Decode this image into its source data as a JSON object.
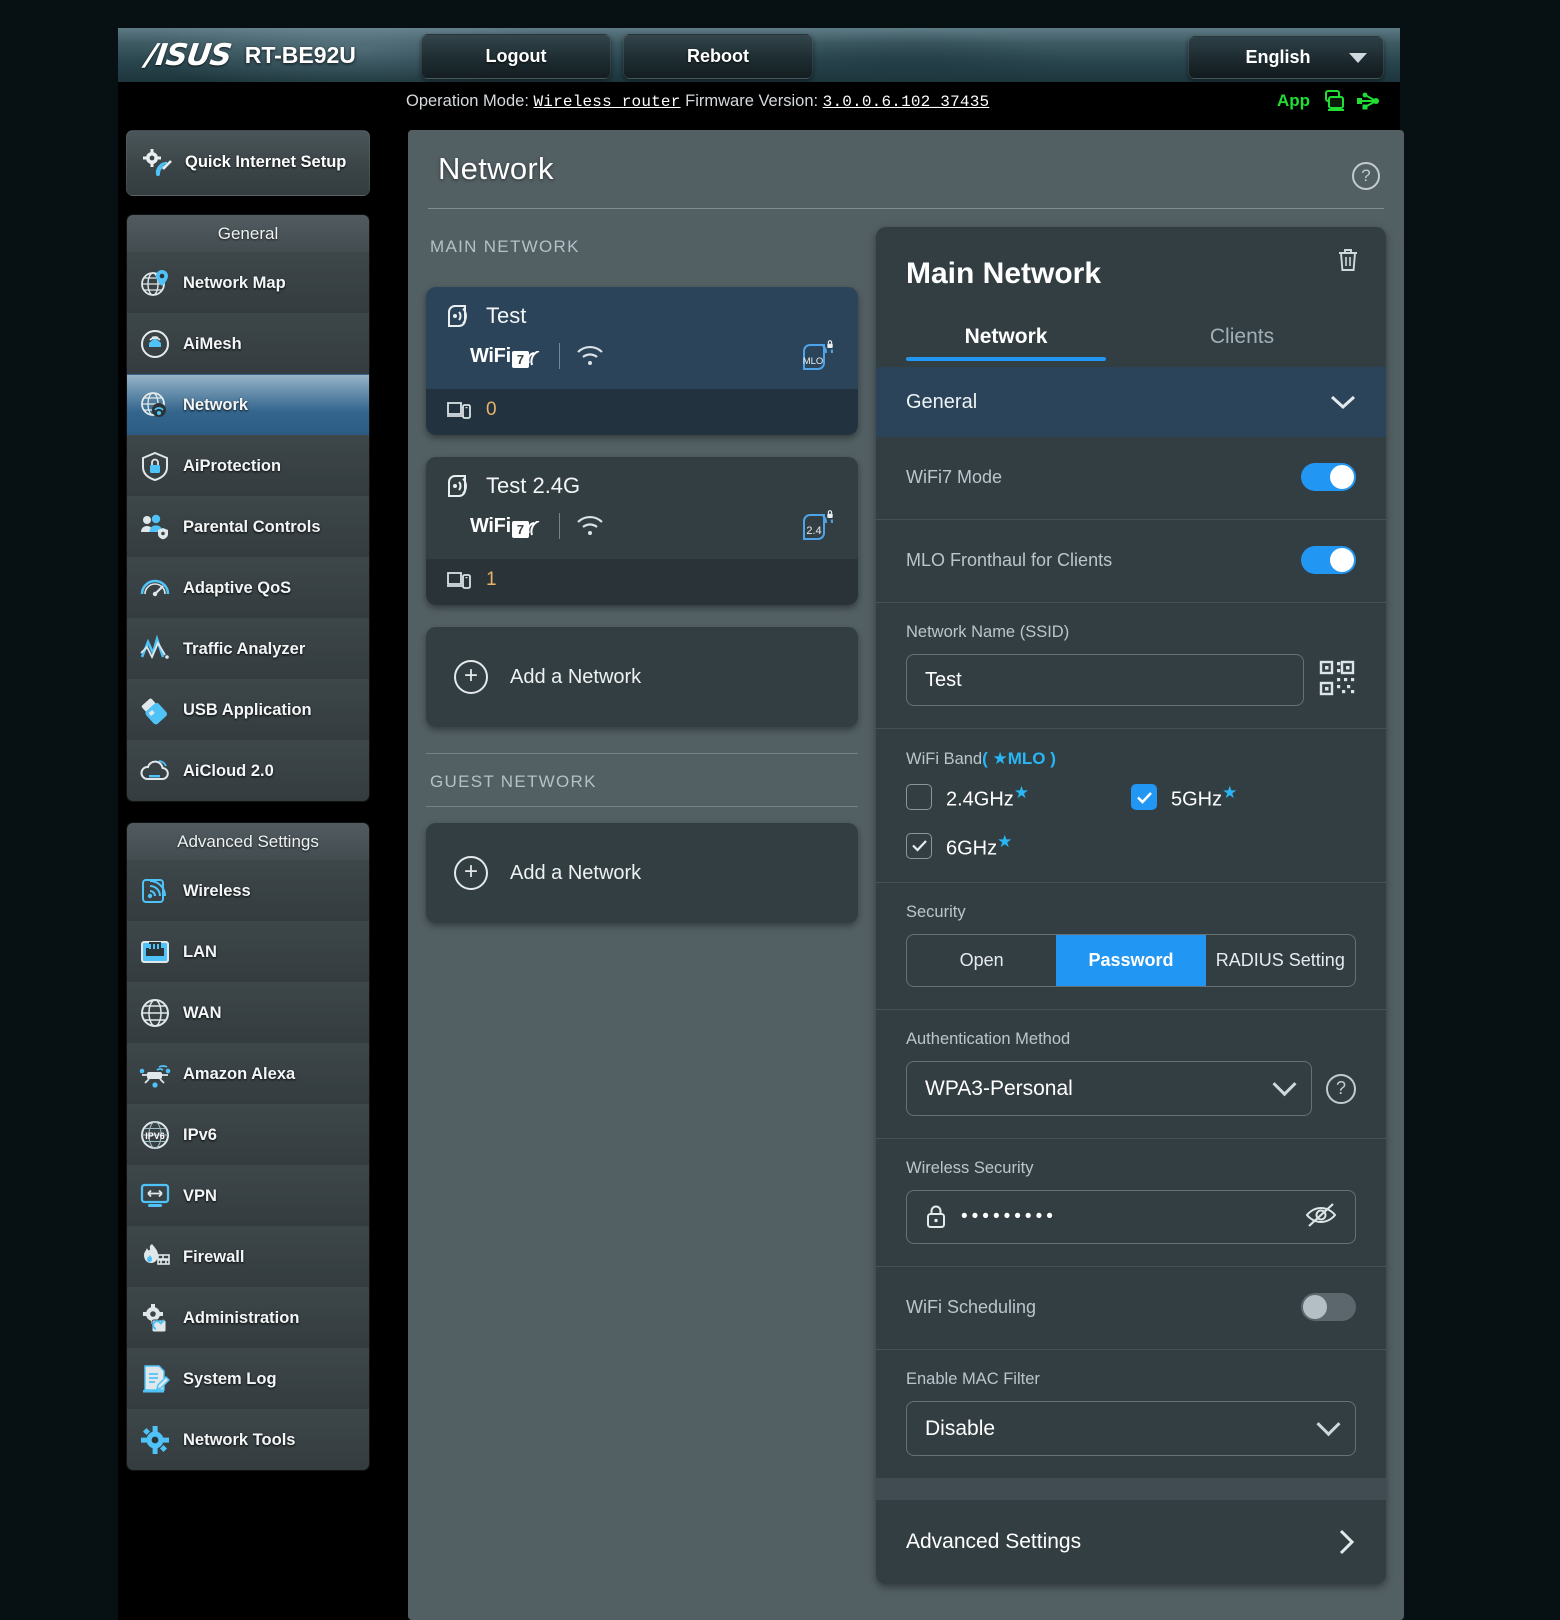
{
  "header": {
    "brand": "/ISUS",
    "model": "RT-BE92U",
    "logout_label": "Logout",
    "reboot_label": "Reboot",
    "language": "English",
    "app_label": "App"
  },
  "infobar": {
    "operation_mode_label": "Operation Mode:",
    "operation_mode_value": "Wireless router",
    "firmware_label": "Firmware Version:",
    "firmware_value": "3.0.0.6.102_37435"
  },
  "sidebar": {
    "quick_setup": "Quick Internet Setup",
    "general_header": "General",
    "general_items": [
      {
        "label": "Network Map",
        "icon": "network-map-icon"
      },
      {
        "label": "AiMesh",
        "icon": "aimesh-icon"
      },
      {
        "label": "Network",
        "icon": "network-icon",
        "active": true
      },
      {
        "label": "AiProtection",
        "icon": "shield-lock-icon"
      },
      {
        "label": "Parental Controls",
        "icon": "parental-controls-icon"
      },
      {
        "label": "Adaptive QoS",
        "icon": "gauge-icon"
      },
      {
        "label": "Traffic Analyzer",
        "icon": "traffic-analyzer-icon"
      },
      {
        "label": "USB Application",
        "icon": "usb-drive-icon"
      },
      {
        "label": "AiCloud 2.0",
        "icon": "cloud-icon"
      }
    ],
    "advanced_header": "Advanced Settings",
    "advanced_items": [
      {
        "label": "Wireless",
        "icon": "wireless-icon"
      },
      {
        "label": "LAN",
        "icon": "lan-port-icon"
      },
      {
        "label": "WAN",
        "icon": "globe-icon"
      },
      {
        "label": "Amazon Alexa",
        "icon": "alexa-icon"
      },
      {
        "label": "IPv6",
        "icon": "ipv6-icon"
      },
      {
        "label": "VPN",
        "icon": "vpn-monitor-icon"
      },
      {
        "label": "Firewall",
        "icon": "firewall-flame-icon"
      },
      {
        "label": "Administration",
        "icon": "admin-gear-icon"
      },
      {
        "label": "System Log",
        "icon": "system-log-icon"
      },
      {
        "label": "Network Tools",
        "icon": "network-tools-icon"
      }
    ]
  },
  "page": {
    "title": "Network",
    "main_network_label": "MAIN NETWORK",
    "guest_network_label": "GUEST NETWORK",
    "add_network_label": "Add a Network",
    "networks": [
      {
        "name": "Test",
        "wifi_standard": "WiFi",
        "wifi_generation": "7",
        "band_badge": "MLO",
        "client_count": "0",
        "selected": true
      },
      {
        "name": "Test 2.4G",
        "wifi_standard": "WiFi",
        "wifi_generation": "7",
        "band_badge": "2.4",
        "client_count": "1",
        "selected": false
      }
    ]
  },
  "detail": {
    "title": "Main Network",
    "tabs": [
      {
        "label": "Network",
        "active": true
      },
      {
        "label": "Clients",
        "active": false
      }
    ],
    "accordion_general": "General",
    "wifi7_mode": {
      "label": "WiFi7 Mode",
      "on": true
    },
    "mlo_fronthaul": {
      "label": "MLO Fronthaul for Clients",
      "on": true
    },
    "ssid": {
      "label": "Network Name (SSID)",
      "value": "Test"
    },
    "wifi_band": {
      "label": "WiFi Band",
      "mlo_note_open": "( ",
      "mlo_note": "MLO",
      "mlo_note_close": " )",
      "bands": [
        {
          "label": "2.4GHz",
          "checked": false,
          "star": true,
          "dim": false
        },
        {
          "label": "5GHz",
          "checked": true,
          "star": true,
          "dim": false
        },
        {
          "label": "6GHz",
          "checked": true,
          "star": true,
          "dim": true
        }
      ]
    },
    "security": {
      "label": "Security",
      "options": [
        {
          "label": "Open",
          "selected": false
        },
        {
          "label": "Password",
          "selected": true
        },
        {
          "label": "RADIUS Setting",
          "selected": false
        }
      ]
    },
    "auth_method": {
      "label": "Authentication Method",
      "value": "WPA3-Personal"
    },
    "wireless_security": {
      "label": "Wireless Security",
      "value": "•••••••••"
    },
    "wifi_scheduling": {
      "label": "WiFi Scheduling",
      "on": false
    },
    "mac_filter": {
      "label": "Enable MAC Filter",
      "value": "Disable"
    },
    "advanced_settings": {
      "label": "Advanced Settings"
    }
  },
  "colors": {
    "accent_blue": "#2196f3",
    "panel_bg": "#525f63",
    "card_bg": "#333e42",
    "selected_card": "#2c4459",
    "green": "#22dd33",
    "amber": "#e8b36a"
  }
}
